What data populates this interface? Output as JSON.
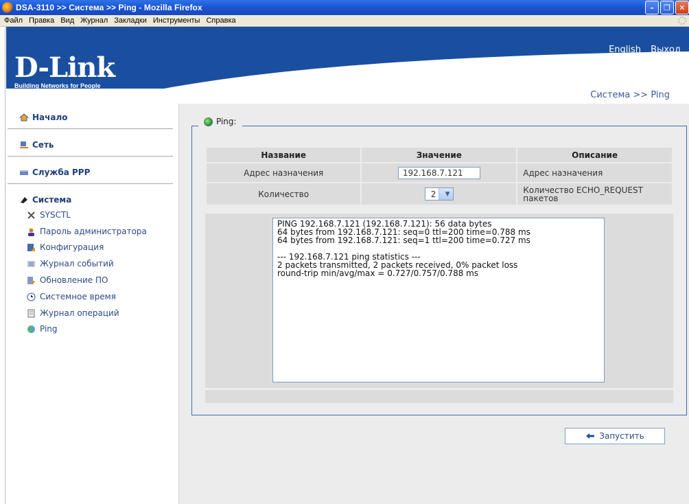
{
  "window": {
    "title": "DSA-3110 >> Система >> Ping - Mozilla Firefox"
  },
  "menu": [
    "Файл",
    "Правка",
    "Вид",
    "Журнал",
    "Закладки",
    "Инструменты",
    "Справка"
  ],
  "header": {
    "logo": "D-Link",
    "tagline": "Building Networks for People",
    "lang_link": "English",
    "logout_link": "Выход",
    "breadcrumb": "Система >> Ping"
  },
  "sidebar": {
    "sections": [
      {
        "label": "Начало",
        "icon": "home-icon"
      },
      {
        "label": "Сеть",
        "icon": "network-icon"
      },
      {
        "label": "Служба PPP",
        "icon": "ppp-icon"
      },
      {
        "label": "Система",
        "icon": "system-icon"
      }
    ],
    "system_items": [
      {
        "label": "SYSCTL",
        "icon": "tools-icon"
      },
      {
        "label": "Пароль администратора",
        "icon": "admin-user-icon"
      },
      {
        "label": "Конфигурация",
        "icon": "config-icon"
      },
      {
        "label": "Журнал событий",
        "icon": "event-log-icon"
      },
      {
        "label": "Обновление ПО",
        "icon": "update-icon"
      },
      {
        "label": "Системное время",
        "icon": "clock-icon"
      },
      {
        "label": "Журнал операций",
        "icon": "operations-log-icon"
      },
      {
        "label": "Ping",
        "icon": "ping-icon"
      }
    ]
  },
  "panel": {
    "legend": "Ping:",
    "columns": [
      "Название",
      "Значение",
      "Описание"
    ],
    "rows": [
      {
        "name": "Адрес назначения",
        "value": "192.168.7.121",
        "desc": "Адрес назначения"
      },
      {
        "name": "Количество",
        "value": "2",
        "desc": "Количество ECHO_REQUEST пакетов"
      }
    ],
    "output": "PING 192.168.7.121 (192.168.7.121): 56 data bytes\n64 bytes from 192.168.7.121: seq=0 ttl=200 time=0.788 ms\n64 bytes from 192.168.7.121: seq=1 ttl=200 time=0.727 ms\n\n--- 192.168.7.121 ping statistics ---\n2 packets transmitted, 2 packets received, 0% packet loss\nround-trip min/avg/max = 0.727/0.757/0.788 ms",
    "run_button": "Запустить"
  },
  "colors": {
    "brand_blue": "#1a4fa0",
    "link_blue": "#2a4a88",
    "panel_border": "#3a6cb0"
  }
}
